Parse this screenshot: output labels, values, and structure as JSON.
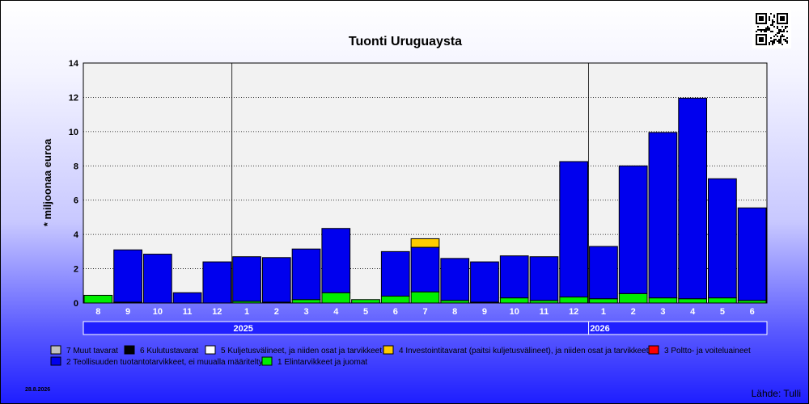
{
  "chart_data": {
    "type": "bar",
    "stacked": true,
    "title": "Tuonti Uruguaysta",
    "ylabel": "* miljoonaa euroa",
    "ylim": [
      0,
      14
    ],
    "yticks": [
      0,
      2,
      4,
      6,
      8,
      10,
      12,
      14
    ],
    "categories": [
      "8",
      "9",
      "10",
      "11",
      "12",
      "1",
      "2",
      "3",
      "4",
      "5",
      "6",
      "7",
      "8",
      "9",
      "10",
      "11",
      "12",
      "1",
      "2",
      "3",
      "4",
      "5",
      "6"
    ],
    "year_groups": [
      {
        "label": "2025",
        "start": 5,
        "end": 16
      },
      {
        "label": "2026",
        "start": 17,
        "end": 22
      }
    ],
    "grid": true,
    "legend_position": "bottom",
    "series": [
      {
        "name": "1 Elintarvikkeet ja juomat",
        "color": "#00ee00",
        "values": [
          0.45,
          0.05,
          0.0,
          0.0,
          0.0,
          0.1,
          0.05,
          0.2,
          0.6,
          0.2,
          0.4,
          0.65,
          0.15,
          0.05,
          0.3,
          0.15,
          0.35,
          0.25,
          0.55,
          0.3,
          0.25,
          0.3,
          0.15
        ]
      },
      {
        "name": "2 Teollisuuden tuotantotarvikkeet, ei muualla määritelty",
        "color": "#0000ee",
        "values": [
          0.0,
          3.05,
          2.85,
          0.6,
          2.4,
          2.6,
          2.6,
          2.95,
          3.75,
          0.0,
          2.6,
          2.6,
          2.45,
          2.35,
          2.45,
          2.55,
          7.9,
          3.05,
          7.45,
          9.65,
          11.7,
          6.95,
          5.4
        ]
      },
      {
        "name": "4 Investointitavarat (paitsi kuljetusvälineet), ja niiden osat ja tarvikkeet",
        "color": "#ffcc00",
        "values": [
          0,
          0,
          0,
          0,
          0,
          0,
          0,
          0,
          0,
          0,
          0,
          0.5,
          0,
          0,
          0,
          0,
          0,
          0,
          0,
          0,
          0,
          0,
          0
        ]
      }
    ],
    "legend": [
      {
        "name": "7 Muut tavarat",
        "color": "#c0c0c0"
      },
      {
        "name": "6 Kulutustavarat",
        "color": "#000000"
      },
      {
        "name": "5 Kuljetusvälineet, ja niiden osat ja tarvikkeet",
        "color": "#ffffff"
      },
      {
        "name": "4 Investointitavarat (paitsi kuljetusvälineet), ja niiden osat ja tarvikkeet",
        "color": "#ffcc00"
      },
      {
        "name": "3 Poltto- ja voiteluaineet",
        "color": "#ff0000"
      },
      {
        "name": "2 Teollisuuden tuotantotarvikkeet, ei muualla määritelty",
        "color": "#0000ee"
      },
      {
        "name": "1 Elintarvikkeet ja juomat",
        "color": "#00ee00"
      }
    ]
  },
  "footer": {
    "date": "28.8.2026",
    "source": "Lähde: Tulli"
  }
}
